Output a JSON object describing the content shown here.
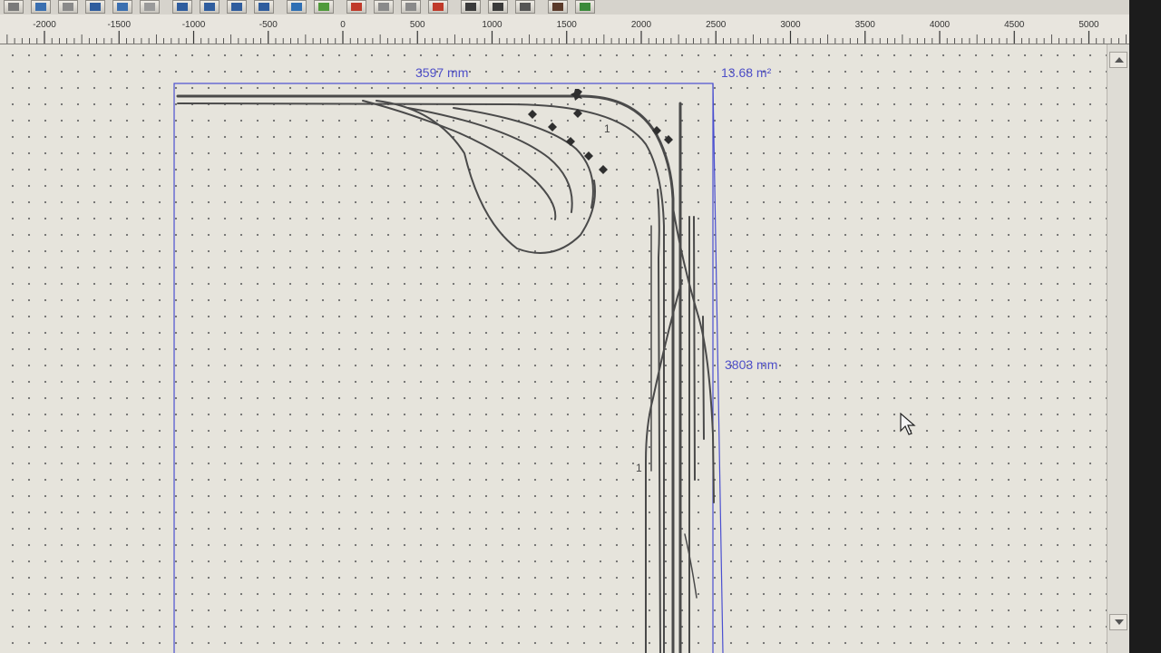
{
  "toolbar": {
    "buttons": [
      "new",
      "open",
      "delete",
      "save",
      "undo",
      "redo",
      "zoom-in",
      "zoom-out",
      "zoom-fit",
      "zoom-window",
      "image",
      "layers",
      "signal-red",
      "signal-n",
      "signal-down",
      "signal-exit",
      "bridge",
      "track-section",
      "grid-menu",
      "figure",
      "locomotive"
    ]
  },
  "ruler": {
    "ticks": [
      "-2000",
      "-1500",
      "-1000",
      "-500",
      "0",
      "500",
      "1000",
      "1500",
      "2000",
      "2500",
      "3000",
      "3500",
      "4000",
      "4500",
      "5000"
    ],
    "tick_values": [
      -2000,
      -1500,
      -1000,
      -500,
      0,
      500,
      1000,
      1500,
      2000,
      2500,
      3000,
      3500,
      4000,
      4500,
      5000
    ]
  },
  "plan": {
    "width_label": "3597 mm",
    "height_label": "3803 mm",
    "area_label": "13.68 m²",
    "track_numbers": [
      "1",
      "1"
    ],
    "colors": {
      "frame": "#4a4fd0",
      "track": "#4a4a4a",
      "dims": "#4d4ec8"
    }
  }
}
